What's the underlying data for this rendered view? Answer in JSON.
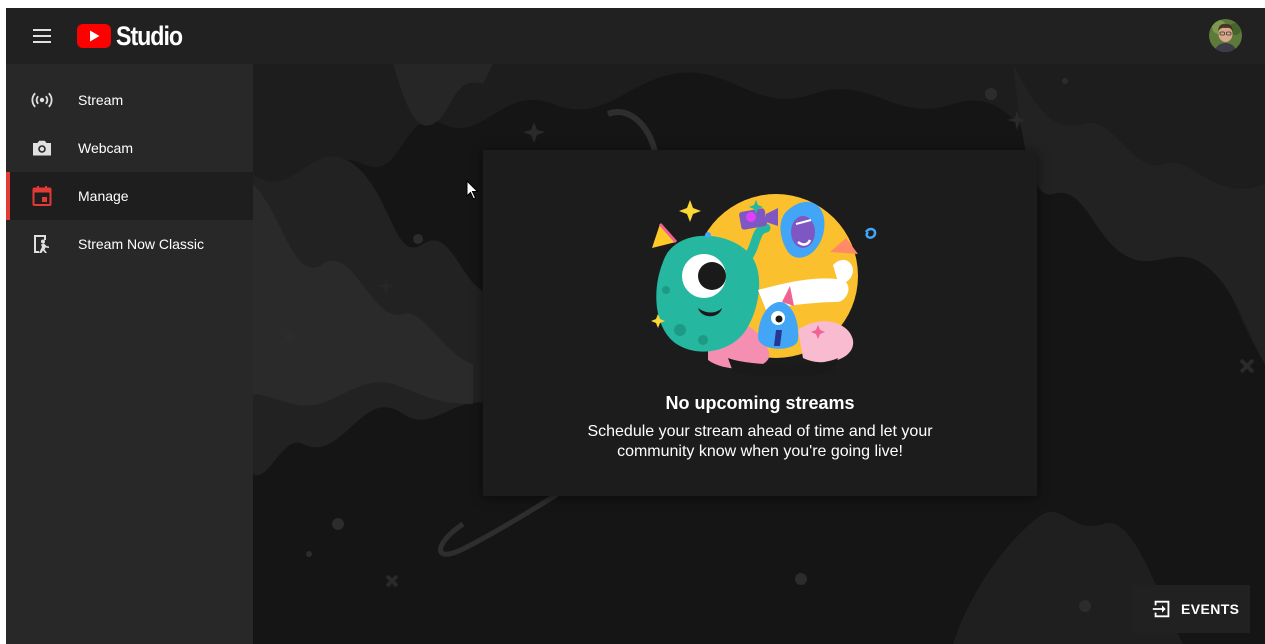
{
  "brand": {
    "name": "Studio"
  },
  "sidebar": {
    "items": [
      {
        "label": "Stream",
        "icon": "broadcast-icon",
        "active": false
      },
      {
        "label": "Webcam",
        "icon": "camera-icon",
        "active": false
      },
      {
        "label": "Manage",
        "icon": "calendar-icon",
        "active": true
      },
      {
        "label": "Stream Now Classic",
        "icon": "classic-stream-icon",
        "active": false
      }
    ]
  },
  "main": {
    "empty_state": {
      "title": "No upcoming streams",
      "description": "Schedule your stream ahead of time and let your community know when you're going live!"
    },
    "events_button": {
      "label": "EVENTS",
      "icon": "exit-to-app-icon"
    }
  },
  "colors": {
    "accent": "#e53935",
    "youtube_red": "#ff0000",
    "topbar": "#212121",
    "sidebar": "#282828",
    "background": "#151515"
  }
}
